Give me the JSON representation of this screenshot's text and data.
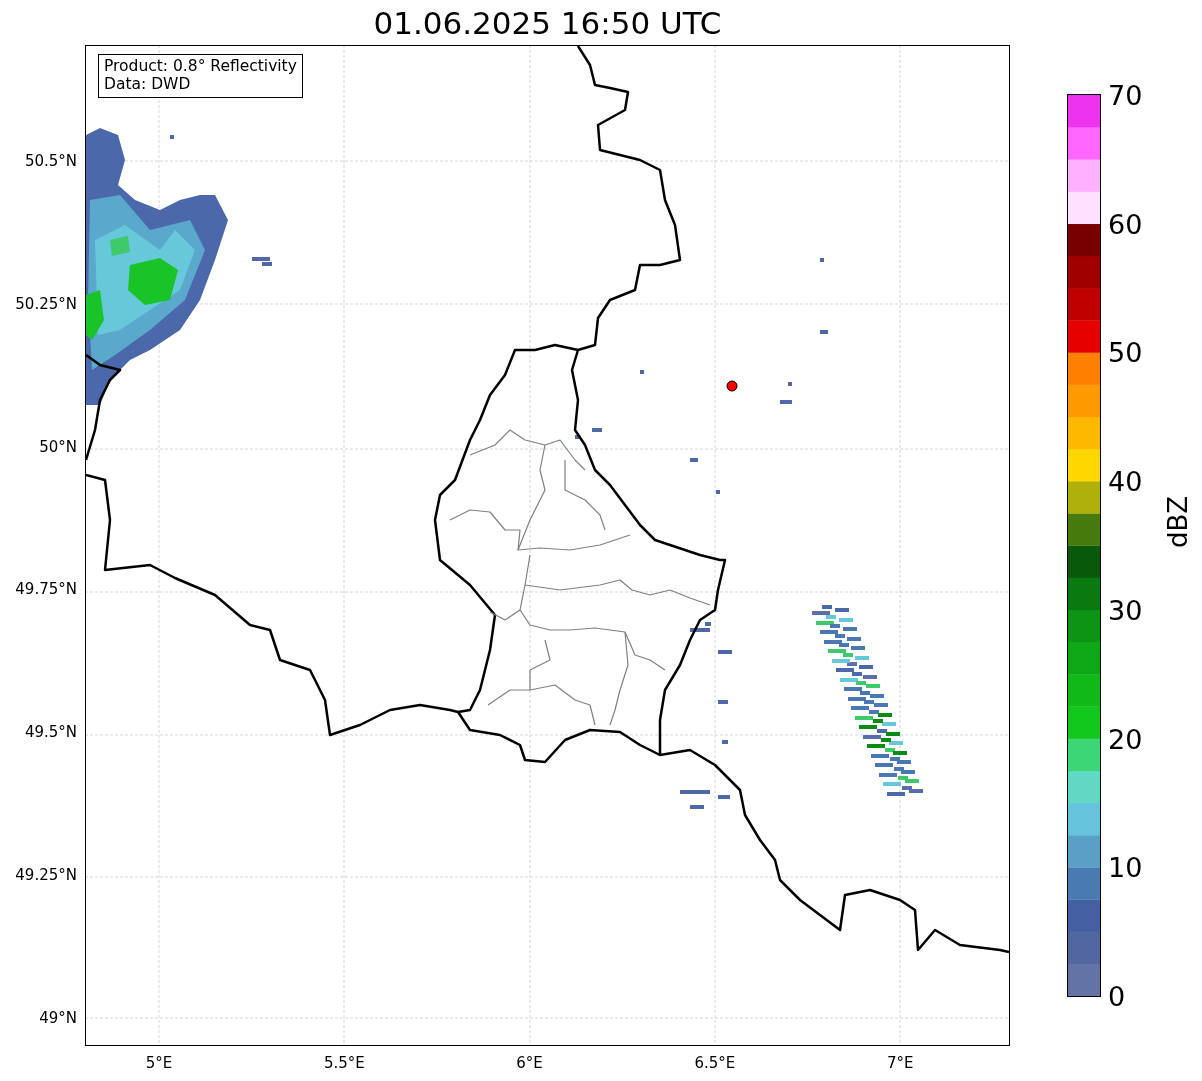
{
  "title": "01.06.2025 16:50 UTC",
  "legend": {
    "lines": [
      "Product: 0.8° Reflectivity",
      "Data: DWD"
    ]
  },
  "map": {
    "x_ticks": [
      "5°E",
      "5.5°E",
      "6°E",
      "6.5°E",
      "7°E"
    ],
    "y_ticks": [
      "50.5°N",
      "50.25°N",
      "50°N",
      "49.75°N",
      "49.5°N",
      "49.25°N",
      "49°N"
    ]
  },
  "colorbar": {
    "label": "dBZ",
    "ticks": [
      "70",
      "60",
      "50",
      "40",
      "30",
      "20",
      "10",
      "0"
    ],
    "bins": [
      {
        "color": "#6473a6"
      },
      {
        "color": "#5266a0"
      },
      {
        "color": "#4460a3"
      },
      {
        "color": "#4a7ab2"
      },
      {
        "color": "#5a9fc6"
      },
      {
        "color": "#66c3dc"
      },
      {
        "color": "#60d8c4"
      },
      {
        "color": "#3dd674"
      },
      {
        "color": "#12c71c"
      },
      {
        "color": "#10b818"
      },
      {
        "color": "#0ea816"
      },
      {
        "color": "#0c9514"
      },
      {
        "color": "#0a7a10"
      },
      {
        "color": "#085a0a"
      },
      {
        "color": "#467a0c"
      },
      {
        "color": "#b0b00a"
      },
      {
        "color": "#ffd700"
      },
      {
        "color": "#ffb800"
      },
      {
        "color": "#ff9900"
      },
      {
        "color": "#ff7f00"
      },
      {
        "color": "#e60000"
      },
      {
        "color": "#c00000"
      },
      {
        "color": "#a00000"
      },
      {
        "color": "#780000"
      },
      {
        "color": "#ffe0ff"
      },
      {
        "color": "#ffb0ff"
      },
      {
        "color": "#ff66ff"
      },
      {
        "color": "#ee33ee"
      }
    ]
  }
}
